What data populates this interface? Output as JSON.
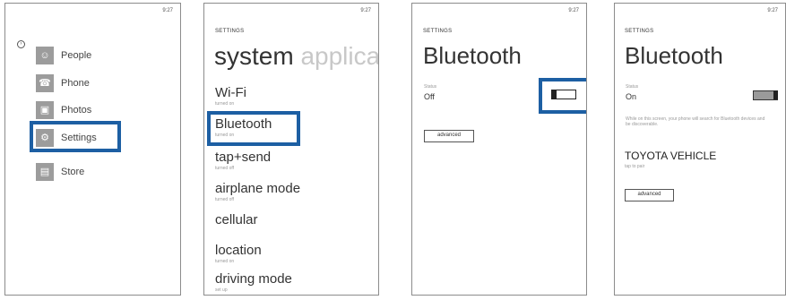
{
  "status_time": "9:27",
  "start_screen": {
    "apps": [
      {
        "label": "People",
        "icon": "people-icon"
      },
      {
        "label": "Phone",
        "icon": "phone-icon"
      },
      {
        "label": "Photos",
        "icon": "photos-icon"
      },
      {
        "label": "Settings",
        "icon": "settings-icon"
      },
      {
        "label": "Store",
        "icon": "store-icon"
      }
    ]
  },
  "settings_list": {
    "header": "SETTINGS",
    "pivot_active": "system",
    "pivot_next": "applica",
    "items": [
      {
        "label": "Wi-Fi",
        "sub": "turned on"
      },
      {
        "label": "Bluetooth",
        "sub": "turned on"
      },
      {
        "label": "tap+send",
        "sub": "turned off"
      },
      {
        "label": "airplane mode",
        "sub": "turned off"
      },
      {
        "label": "cellular",
        "sub": ""
      },
      {
        "label": "location",
        "sub": "turned on"
      },
      {
        "label": "driving mode",
        "sub": "set up"
      }
    ]
  },
  "bluetooth_off": {
    "header": "SETTINGS",
    "title": "Bluetooth",
    "status_caption": "Status",
    "status_value": "Off",
    "advanced_label": "advanced"
  },
  "bluetooth_on": {
    "header": "SETTINGS",
    "title": "Bluetooth",
    "status_caption": "Status",
    "status_value": "On",
    "description": "While on this screen, your phone will search for Bluetooth devices and be discoverable.",
    "device_name": "TOYOTA VEHICLE",
    "device_status": "tap to pair",
    "advanced_label": "advanced"
  },
  "colors": {
    "highlight": "#1d5fa3",
    "tile": "#9c9c9c"
  }
}
